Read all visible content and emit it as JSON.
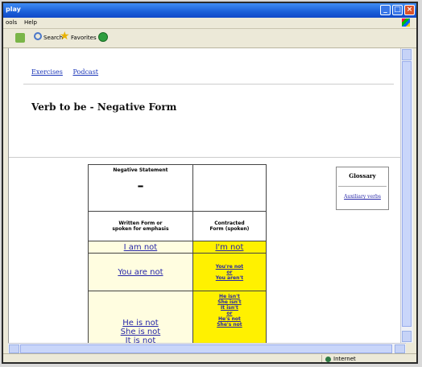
{
  "window": {
    "title": "play"
  },
  "menu": {
    "items": [
      "ools",
      "Help"
    ]
  },
  "toolbar": {
    "search_label": "Search",
    "favorites_label": "Favorites"
  },
  "nav": {
    "links": [
      "Exercises",
      "Podcast"
    ]
  },
  "page": {
    "title": "Verb to be - Negative Form"
  },
  "table": {
    "header_left": "Negative Statement",
    "header_symbol": "–",
    "sub_left": [
      "Written Form or",
      "spoken for emphasis"
    ],
    "sub_right": [
      "Contracted",
      "Form (spoken)"
    ],
    "rows": [
      {
        "written": [
          "I am not"
        ],
        "contracted": [
          "I'm not"
        ]
      },
      {
        "written": [
          "You are not"
        ],
        "contracted": [
          "You're not",
          "or",
          "You aren't"
        ]
      },
      {
        "written": [
          "He is not",
          "She is not",
          "It is not"
        ],
        "contracted": [
          "He isn't",
          "She isn't",
          "It isn't",
          "or",
          "He's not",
          "She's not"
        ]
      }
    ]
  },
  "glossary": {
    "title": "Glossary",
    "link": "Auxiliary verbs"
  },
  "status": {
    "zone": "Internet"
  },
  "colors": {
    "written_bg": "#fffde0",
    "contracted_bg": "#fff100",
    "link": "#2626a8"
  }
}
